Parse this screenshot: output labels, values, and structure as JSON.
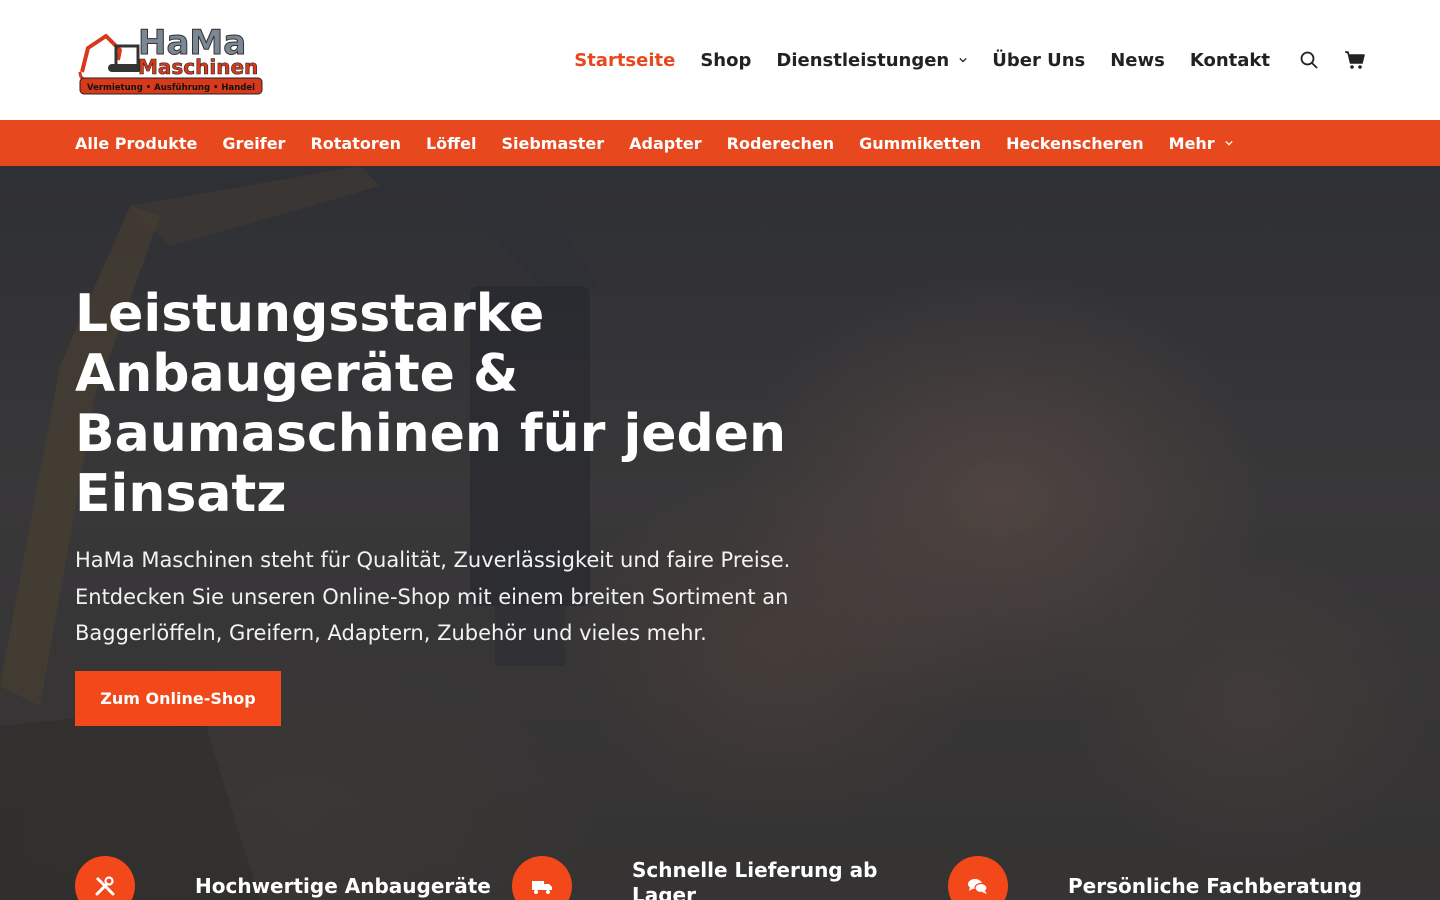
{
  "brand": {
    "logo_line1": "HaMa",
    "logo_line2": "Maschinen",
    "tagline": "Vermietung • Ausführung • Handel"
  },
  "main_nav": [
    {
      "label": "Startseite",
      "active": true
    },
    {
      "label": "Shop"
    },
    {
      "label": "Dienstleistungen",
      "has_dropdown": true
    },
    {
      "label": "Über Uns"
    },
    {
      "label": "News"
    },
    {
      "label": "Kontakt"
    }
  ],
  "header_icons": [
    "search-icon",
    "cart-icon"
  ],
  "category_nav": [
    "Alle Produkte",
    "Greifer",
    "Rotatoren",
    "Löffel",
    "Siebmaster",
    "Adapter",
    "Roderechen",
    "Gummiketten",
    "Heckenscheren",
    "Mehr"
  ],
  "hero": {
    "title": "Leistungsstarke Anbaugeräte & Baumaschinen für jeden Einsatz",
    "text": "HaMa Maschinen steht für Qualität, Zuverlässigkeit und faire Preise. Entdecken Sie unseren Online-Shop mit einem breiten Sortiment an Baggerlöffeln, Greifern, Adaptern, Zubehör und vieles mehr.",
    "button": "Zum Online-Shop"
  },
  "features": [
    {
      "icon": "tools-icon",
      "title": "Hochwertige Anbaugeräte"
    },
    {
      "icon": "truck-icon",
      "title": "Schnelle Lieferung ab Lager"
    },
    {
      "icon": "chat-icon",
      "title": "Persönliche Fachberatung"
    }
  ],
  "colors": {
    "accent": "#e8481e",
    "button": "#f2481a",
    "text_dark": "#222222"
  }
}
